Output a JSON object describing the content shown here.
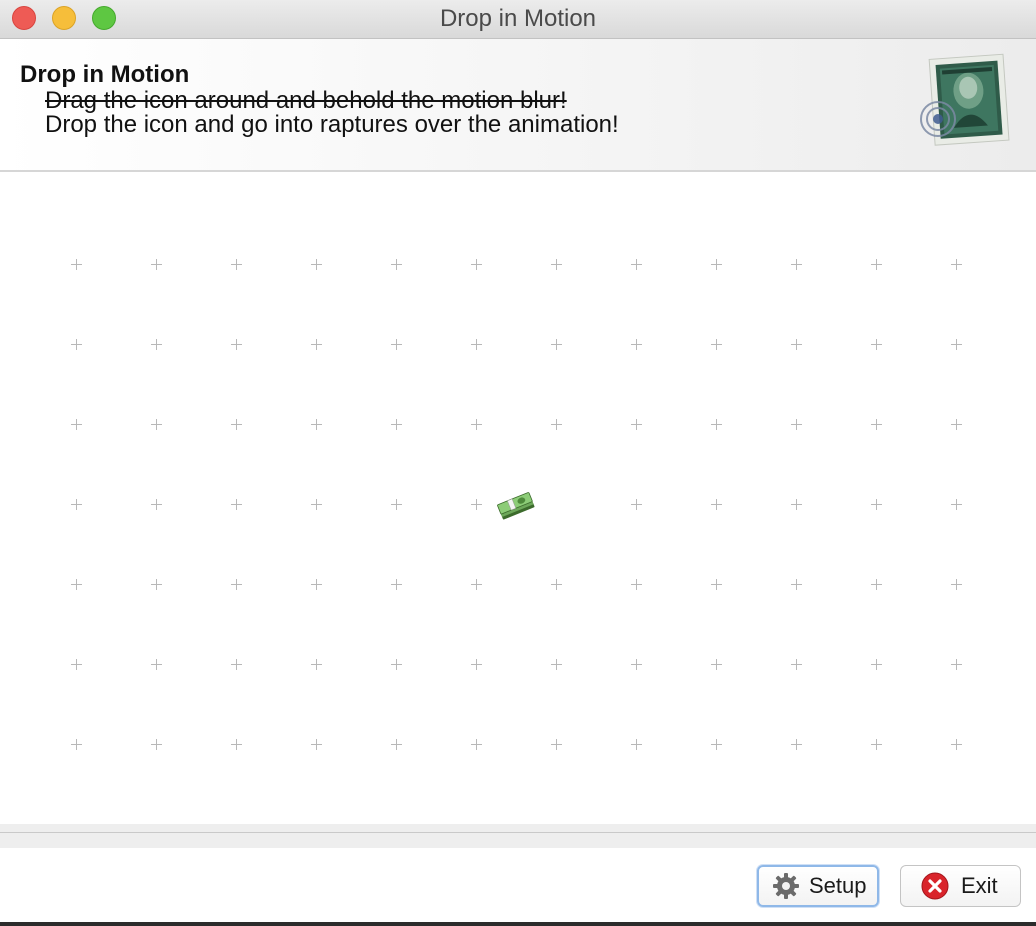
{
  "window": {
    "title": "Drop in Motion"
  },
  "header": {
    "title": "Drop in Motion",
    "line1": "Drag the icon around and behold the motion blur!",
    "line2": "Drop the icon and go into raptures over the animation!",
    "image_icon": "postage-stamp-icon"
  },
  "canvas": {
    "grid_icon": "plus-marker",
    "grid_columns": 12,
    "grid_rows": 7,
    "draggable_icon": "money-stack-icon"
  },
  "footer": {
    "setup_label": "Setup",
    "setup_icon": "gear-icon",
    "exit_label": "Exit",
    "exit_icon": "close-circle-icon"
  },
  "colors": {
    "close": "#ee5b55",
    "minimize": "#f6be3a",
    "maximize": "#5ec742",
    "grid_marker": "#b8b8b8",
    "exit_icon": "#d9242b",
    "focus_ring": "#8fb8e8"
  }
}
